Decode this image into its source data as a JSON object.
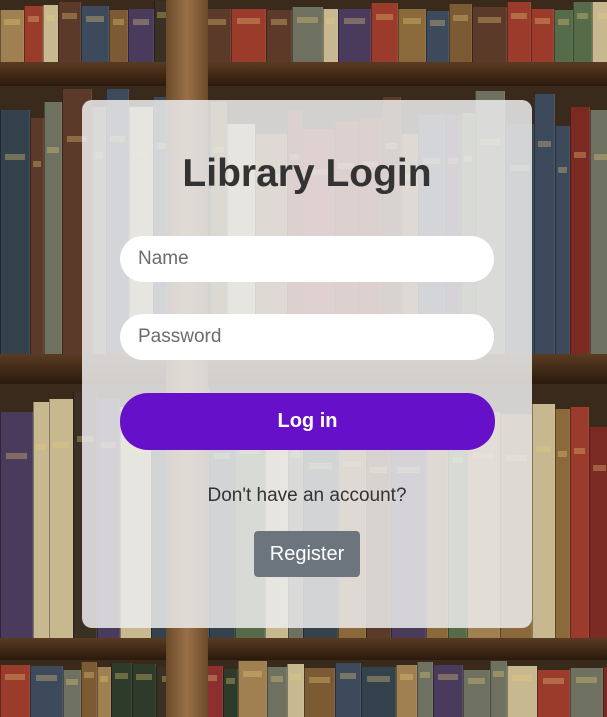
{
  "login": {
    "title": "Library Login",
    "name_placeholder": "Name",
    "password_placeholder": "Password",
    "login_label": "Log in",
    "account_prompt": "Don't have an account?",
    "register_label": "Register"
  },
  "colors": {
    "primary_button": "#6710c9",
    "secondary_button": "#6c757d",
    "card_background": "#ececec",
    "title_text": "#333333"
  }
}
